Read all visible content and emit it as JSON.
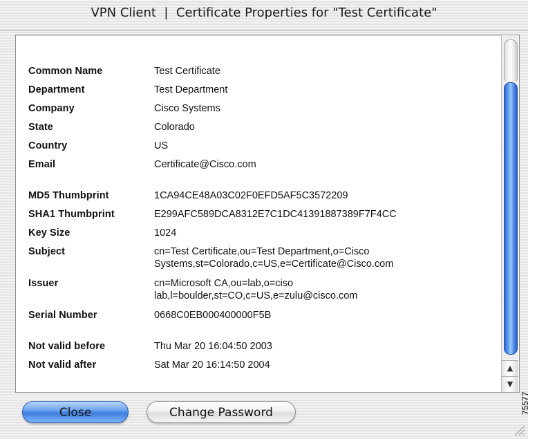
{
  "window": {
    "title": "VPN Client  |  Certificate Properties for \"Test Certificate\""
  },
  "groups": [
    {
      "rows": [
        {
          "label": "Common Name",
          "value": "Test Certificate"
        },
        {
          "label": "Department",
          "value": "Test Department"
        },
        {
          "label": "Company",
          "value": "Cisco Systems"
        },
        {
          "label": "State",
          "value": "Colorado"
        },
        {
          "label": "Country",
          "value": "US"
        },
        {
          "label": "Email",
          "value": "Certificate@Cisco.com"
        }
      ]
    },
    {
      "rows": [
        {
          "label": "MD5 Thumbprint",
          "value": "1CA94CE48A03C02F0EFD5AF5C3572209"
        },
        {
          "label": "SHA1 Thumbprint",
          "value": "E299AFC589DCA8312E7C1DC41391887389F7F4CC"
        },
        {
          "label": "Key Size",
          "value": "1024"
        },
        {
          "label": "Subject",
          "value": "cn=Test Certificate,ou=Test Department,o=Cisco Systems,st=Colorado,c=US,e=Certificate@Cisco.com"
        },
        {
          "label": "Issuer",
          "value": "cn=Microsoft CA,ou=lab,o=ciso lab,l=boulder,st=CO,c=US,e=zulu@cisco.com"
        },
        {
          "label": "Serial Number",
          "value": "0668C0EB000400000F5B"
        }
      ]
    },
    {
      "rows": [
        {
          "label": "Not valid before",
          "value": "Thu Mar 20 16:04:50 2003"
        },
        {
          "label": "Not valid after",
          "value": "Sat Mar 20 16:14:50 2004"
        }
      ]
    }
  ],
  "buttons": {
    "close": "Close",
    "change_password": "Change Password"
  },
  "scrollbar": {
    "up_icon": "triangle-up",
    "down_icon": "triangle-down"
  },
  "figure_number": "75577"
}
